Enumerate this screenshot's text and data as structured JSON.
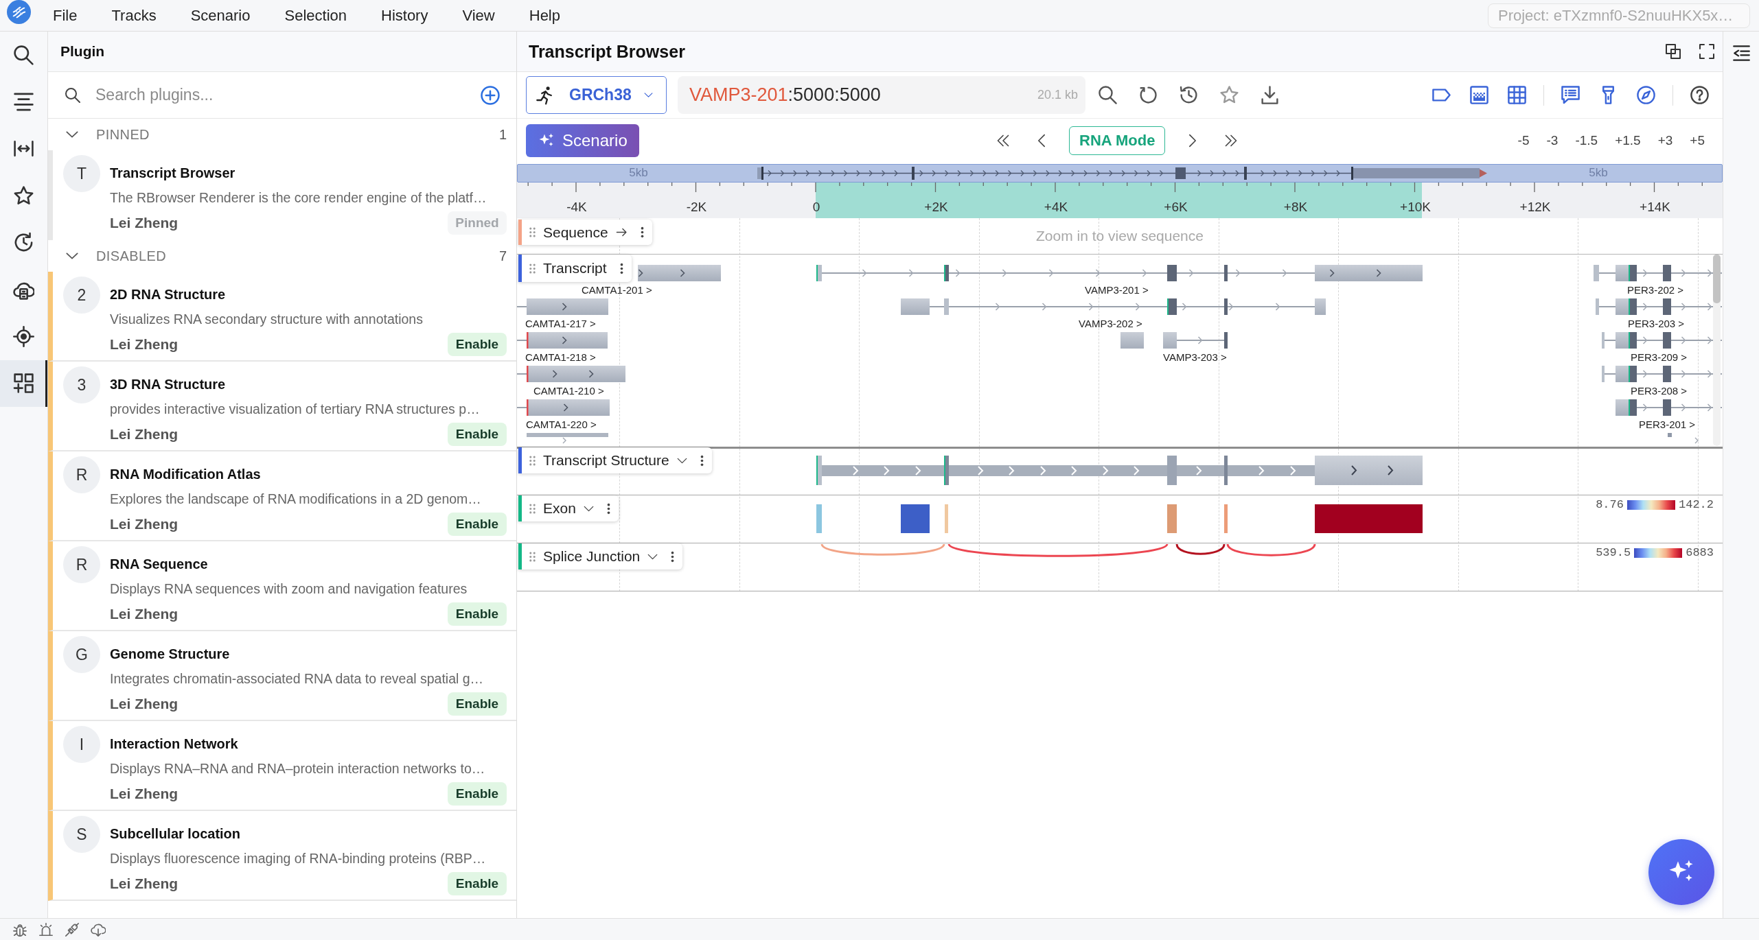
{
  "menu_bar": {
    "items": [
      "File",
      "Tracks",
      "Scenario",
      "Selection",
      "History",
      "View",
      "Help"
    ],
    "project": "Project: eTXzmnf0-S2nuuHKX5x…"
  },
  "activity_bar": [
    {
      "kind": "search",
      "selected": false
    },
    {
      "kind": "outline",
      "selected": false
    },
    {
      "kind": "fit",
      "selected": false
    },
    {
      "kind": "favorites",
      "selected": false
    },
    {
      "kind": "history",
      "selected": false
    },
    {
      "kind": "cloud",
      "selected": false
    },
    {
      "kind": "locate",
      "selected": false
    },
    {
      "kind": "plugins",
      "selected": true
    }
  ],
  "plugin_panel": {
    "title": "Plugin",
    "search": {
      "placeholder": "Search plugins..."
    },
    "sections": [
      {
        "kind": "pinned",
        "label": "PINNED",
        "count": "1",
        "expanded": true,
        "plugins": [
          {
            "avatar": "T",
            "name": "Transcript Browser",
            "description": "The RBrowser Renderer is the core render engine of the platf…",
            "author": "Lei Zheng",
            "action": "Pinned"
          }
        ]
      },
      {
        "kind": "disabled",
        "label": "DISABLED",
        "count": "7",
        "expanded": true,
        "plugins": [
          {
            "avatar": "2",
            "name": "2D RNA Structure",
            "description": "Visualizes RNA secondary structure with annotations",
            "author": "Lei Zheng",
            "action": "Enable"
          },
          {
            "avatar": "3",
            "name": "3D RNA Structure",
            "description": "provides interactive visualization of tertiary RNA structures p…",
            "author": "Lei Zheng",
            "action": "Enable"
          },
          {
            "avatar": "R",
            "name": "RNA Modification Atlas",
            "description": "Explores the landscape of RNA modifications in a 2D genom…",
            "author": "Lei Zheng",
            "action": "Enable"
          },
          {
            "avatar": "R",
            "name": "RNA Sequence",
            "description": "Displays RNA sequences with zoom and navigation features",
            "author": "Lei Zheng",
            "action": "Enable"
          },
          {
            "avatar": "G",
            "name": "Genome Structure",
            "description": "Integrates chromatin-associated RNA data to reveal spatial g…",
            "author": "Lei Zheng",
            "action": "Enable"
          },
          {
            "avatar": "I",
            "name": "Interaction Network",
            "description": "Displays RNA–RNA and RNA–protein interaction networks to…",
            "author": "Lei Zheng",
            "action": "Enable"
          },
          {
            "avatar": "S",
            "name": "Subcellular location",
            "description": "Displays fluorescence imaging of RNA-binding proteins (RBP…",
            "author": "Lei Zheng",
            "action": "Enable"
          }
        ]
      }
    ]
  },
  "browser": {
    "title": "Transcript Browser",
    "genome": "GRCh38",
    "locus": {
      "gene": "VAMP3-201",
      "range": ":5000:5000",
      "span": "20.1 kb"
    },
    "scenario_button": "Scenario",
    "mode_button": "RNA Mode",
    "zoom_steps": [
      "-5",
      "-3",
      "-1.5",
      "+1.5",
      "+3",
      "+5"
    ],
    "overview": {
      "scale_labels": [
        "5kb",
        "5kb"
      ]
    },
    "ruler": {
      "ticks": [
        "-4K",
        "-2K",
        "0",
        "+2K",
        "+4K",
        "+6K",
        "+8K",
        "+10K",
        "+12K",
        "+14K"
      ]
    },
    "tracks": [
      {
        "kind": "sequence",
        "name": "Sequence",
        "color": "#f4a387",
        "message": "Zoom in to view sequence"
      },
      {
        "kind": "transcript",
        "name": "Transcript",
        "color": "#3d62dc",
        "transcripts": [
          {
            "label": "CAMTA1-201 >"
          },
          {
            "label": "VAMP3-201 >"
          },
          {
            "label": "PER3-202 >"
          },
          {
            "label": "CAMTA1-217 >"
          },
          {
            "label": "VAMP3-202 >"
          },
          {
            "label": "PER3-203 >"
          },
          {
            "label": "CAMTA1-218 >"
          },
          {
            "label": "VAMP3-203 >"
          },
          {
            "label": "PER3-209 >"
          },
          {
            "label": "CAMTA1-210 >"
          },
          {
            "label": "PER3-208 >"
          },
          {
            "label": "CAMTA1-220 >"
          },
          {
            "label": "PER3-201 >"
          }
        ]
      },
      {
        "kind": "structure",
        "name": "Transcript Structure",
        "color": "#3d62dc"
      },
      {
        "kind": "exon",
        "name": "Exon",
        "color": "#14b887",
        "scale": {
          "min": "8.76",
          "max": "142.2"
        }
      },
      {
        "kind": "junction",
        "name": "Splice Junction",
        "color": "#14b887",
        "scale": {
          "min": "539.5",
          "max": "6883"
        }
      }
    ]
  }
}
